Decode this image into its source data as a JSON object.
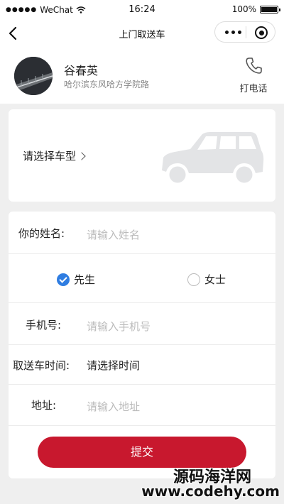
{
  "status_bar": {
    "carrier": "WeChat",
    "time": "16:24",
    "battery": "100%"
  },
  "nav": {
    "title": "上门取送车"
  },
  "profile": {
    "name": "谷春英",
    "address": "哈尔滨东风哈方学院路",
    "call_label": "打电话"
  },
  "car": {
    "choose_label": "请选择车型"
  },
  "form": {
    "name_label": "你的姓名:",
    "name_placeholder": "请输入姓名",
    "gender_male": "先生",
    "gender_female": "女士",
    "phone_label": "手机号:",
    "phone_placeholder": "请输入手机号",
    "time_label": "取送车时间:",
    "time_value": "请选择时间",
    "address_label": "地址:",
    "address_placeholder": "请输入地址",
    "submit_label": "提交"
  },
  "watermark": {
    "line1": "源码海洋网",
    "line2": "www.codehy.com"
  },
  "colors": {
    "accent_red": "#c8182e",
    "radio_blue": "#2f7de1"
  }
}
